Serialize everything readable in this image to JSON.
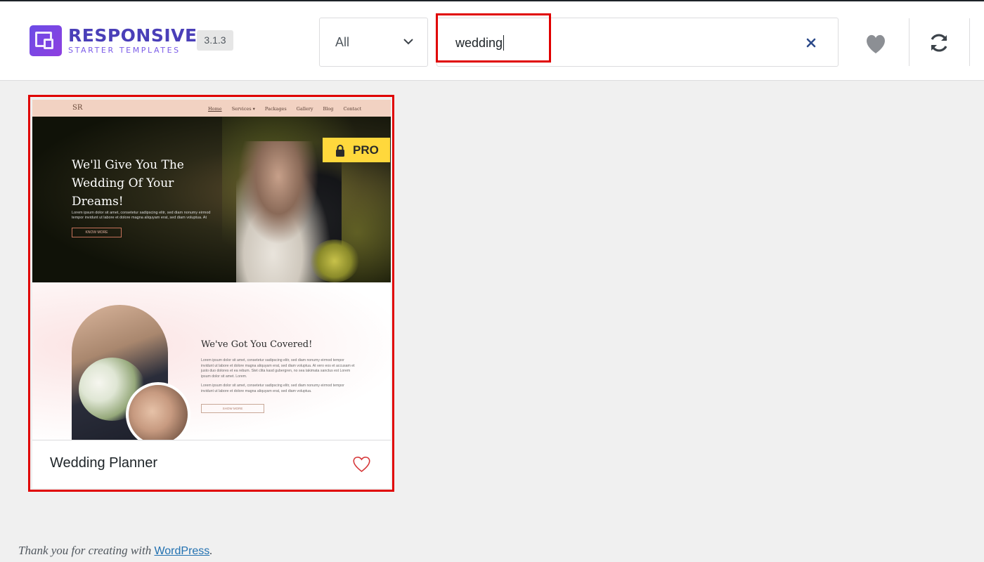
{
  "app": {
    "logo_main": "RESPONSIVE",
    "logo_sub": "STARTER TEMPLATES",
    "version": "3.1.3"
  },
  "toolbar": {
    "category_selected": "All",
    "search_query": "wedding",
    "clear_icon": "close-icon",
    "favorites_icon": "heart-icon",
    "sync_icon": "sync-icon"
  },
  "templates": [
    {
      "title": "Wedding Planner",
      "badge": "PRO",
      "preview": {
        "nav_logo": "SR",
        "nav_links": [
          "Home",
          "Services ▾",
          "Packages",
          "Gallery",
          "Blog",
          "Contact"
        ],
        "hero_heading": "We'll Give You The Wedding Of Your Dreams!",
        "hero_text": "Lorem ipsum dolor sit amet, consetetur sadipscing elitr, sed diam nonumy eirmod tempor invidunt ut labore et dolore magna aliquyam erat, sed diam voluptua. At",
        "hero_button": "KNOW MORE",
        "section_heading": "We've Got You Covered!",
        "section_text_1": "Lorem ipsum dolor sit amet, consetetur sadipscing elitr, sed diam nonumy eirmod tempor invidunt ut labore et dolore magna aliquyam erat, sed diam voluptua. At vero eos et accusam et justo duo dolores et ea rebum. Stet clita kasd gubergren, no sea takimata sanctus est Lorem ipsum dolor sit amet. Lorem.",
        "section_text_2": "Lorem ipsum dolor sit amet, consetetur sadipscing elitr, sed diam nonumy eirmod tempor invidunt ut labore et dolore magna aliquyam erat, sed diam voluptua.",
        "section_button": "SHOW MORE"
      }
    }
  ],
  "footer": {
    "thanks_text": "Thank you for creating with ",
    "link_text": "WordPress",
    "trailing": "."
  },
  "colors": {
    "brand": "#4a3fb8",
    "highlight": "#e00000",
    "pro_badge": "#ffd83c",
    "link": "#2271b1"
  }
}
